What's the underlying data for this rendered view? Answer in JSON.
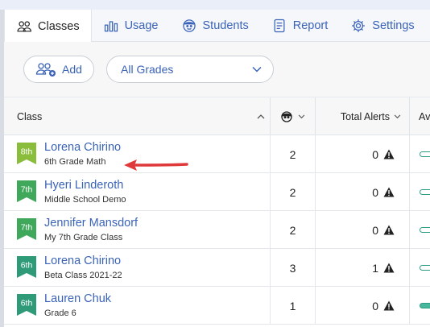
{
  "tabs": [
    {
      "label": "Classes",
      "icon": "people-icon",
      "active": true
    },
    {
      "label": "Usage",
      "icon": "bar-chart-icon",
      "active": false
    },
    {
      "label": "Students",
      "icon": "smiley-face-icon",
      "active": false
    },
    {
      "label": "Report",
      "icon": "report-icon",
      "active": false
    },
    {
      "label": "Settings",
      "icon": "gear-icon",
      "active": false
    }
  ],
  "toolbar": {
    "add_label": "Add",
    "grades_select": "All Grades"
  },
  "table": {
    "columns": {
      "class": "Class",
      "total_alerts": "Total Alerts",
      "avg": "Av"
    },
    "rows": [
      {
        "grade": "8th",
        "grade_color": "#8bbd3c",
        "name": "Lorena Chirino",
        "subtitle": "6th Grade Math",
        "students": "2",
        "alerts": "0",
        "avg_filled": false
      },
      {
        "grade": "7th",
        "grade_color": "#3fa85a",
        "name": "Hyeri Linderoth",
        "subtitle": "Middle School Demo",
        "students": "2",
        "alerts": "0",
        "avg_filled": false
      },
      {
        "grade": "7th",
        "grade_color": "#3fa85a",
        "name": "Jennifer Mansdorf",
        "subtitle": "My 7th Grade Class",
        "students": "2",
        "alerts": "0",
        "avg_filled": false
      },
      {
        "grade": "6th",
        "grade_color": "#2e9a78",
        "name": "Lorena Chirino",
        "subtitle": "Beta Class 2021-22",
        "students": "3",
        "alerts": "1",
        "avg_filled": false
      },
      {
        "grade": "6th",
        "grade_color": "#2e9a78",
        "name": "Lauren Chuk",
        "subtitle": "Grade 6",
        "students": "1",
        "alerts": "0",
        "avg_filled": true
      }
    ]
  },
  "colors": {
    "link": "#3a63b8",
    "arrow": "#e0393b"
  }
}
